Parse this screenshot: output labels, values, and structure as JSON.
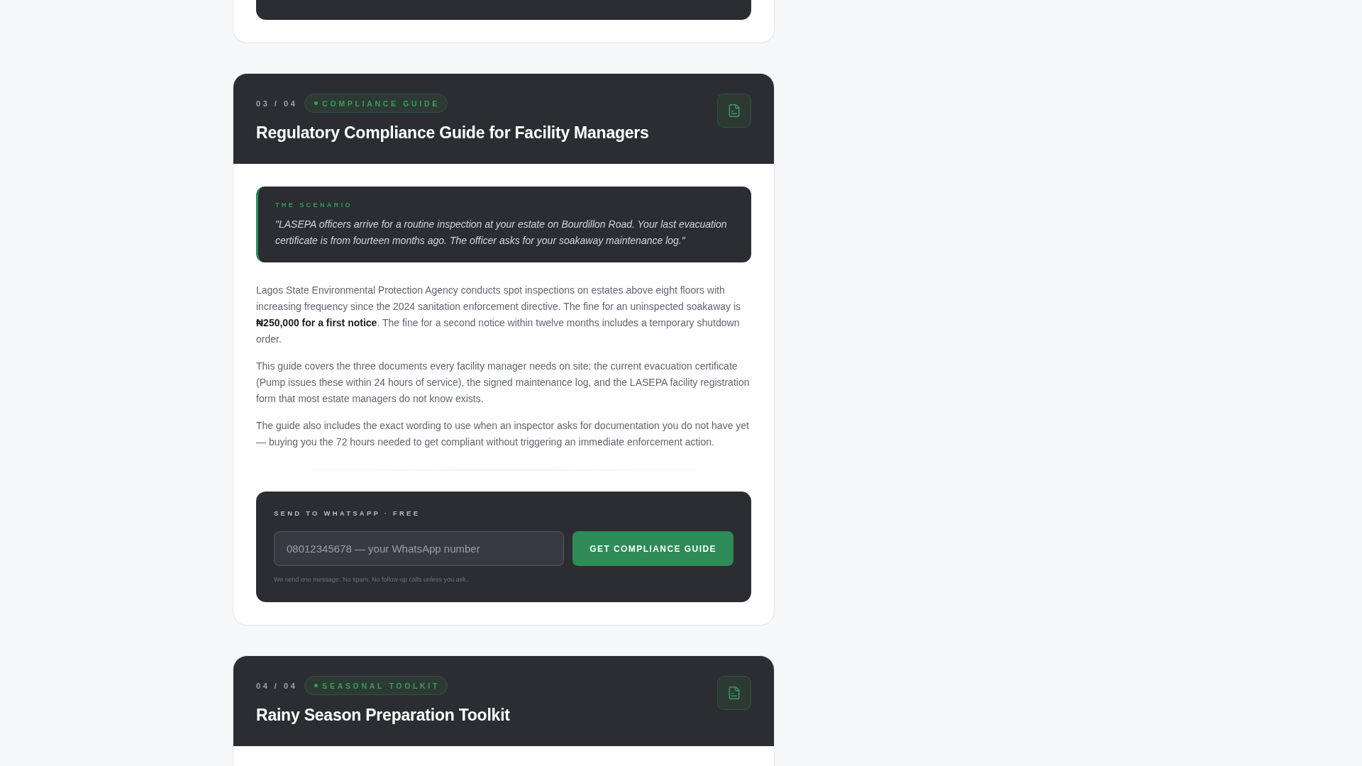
{
  "cards": [
    {
      "counter": "03 / 04",
      "tag": "COMPLIANCE GUIDE",
      "title": "Regulatory Compliance Guide for Facility Managers",
      "scenario": {
        "label": "THE SCENARIO",
        "quote": "\"LASEPA officers arrive for a routine inspection at your estate on Bourdillon Road. Your last evacuation certificate is from fourteen months ago. The officer asks for your soakaway maintenance log.\""
      },
      "paragraphs": [
        "Lagos State Environmental Protection Agency conducts spot inspections on estates above eight floors with increasing frequency since the 2024 sanitation enforcement directive. The fine for an uninspected soakaway is **₦250,000 for a first notice**. The fine for a second notice within twelve months includes a temporary shutdown order.",
        "This guide covers the three documents every facility manager needs on site: the current evacuation certificate (Pump issues these within 24 hours of service), the signed maintenance log, and the LASEPA facility registration form that most estate managers do not know exists.",
        "The guide also includes the exact wording to use when an inspector asks for documentation you do not have yet — buying you the 72 hours needed to get compliant without triggering an immediate enforcement action."
      ],
      "signup": {
        "label": "SEND TO WHATSAPP · FREE",
        "placeholder": "08012345678 — your WhatsApp number",
        "button": "GET COMPLIANCE GUIDE",
        "note": "We send one message. No spam. No follow-up calls unless you ask."
      }
    },
    {
      "counter": "04 / 04",
      "tag": "SEASONAL TOOLKIT",
      "title": "Rainy Season Preparation Toolkit"
    }
  ]
}
